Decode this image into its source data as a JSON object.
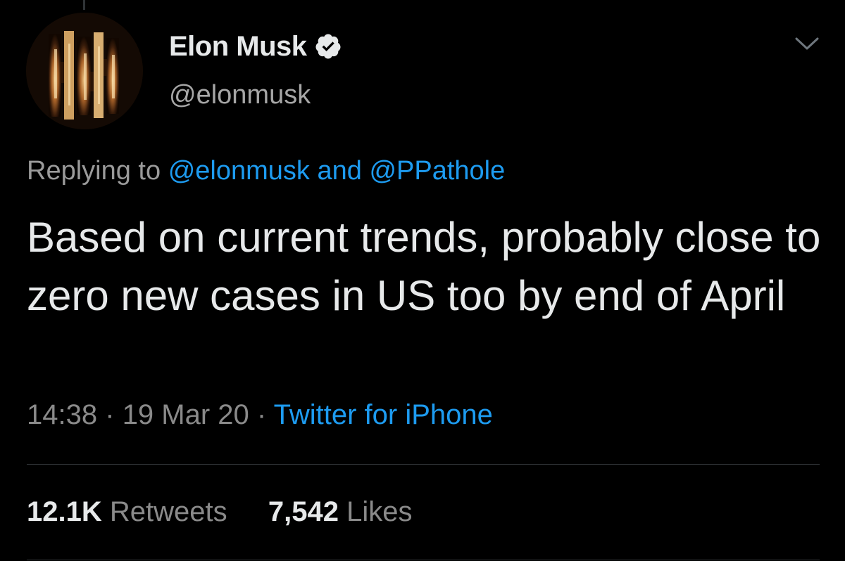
{
  "tweet": {
    "author": {
      "display_name": "Elon Musk",
      "handle": "@elonmusk",
      "verified": true,
      "avatar_icon": "fire-avatar"
    },
    "replying": {
      "prefix": "Replying to",
      "mention_1": "@elonmusk",
      "connector": "and",
      "mention_2": "@PPathole"
    },
    "text": "Based on current trends, probably close to zero new cases in US too by end of April",
    "time": "14:38",
    "separator": "·",
    "date": "19 Mar 20",
    "source": "Twitter for iPhone",
    "stats": {
      "retweets_count": "12.1K",
      "retweets_label": "Retweets",
      "likes_count": "7,542",
      "likes_label": "Likes"
    }
  },
  "colors": {
    "background": "#000000",
    "link": "#1d9bf0",
    "primary_text": "#e7e9ea",
    "secondary_text": "#8a8a8a"
  },
  "icons": {
    "verified": "verified-badge-icon",
    "more": "chevron-down-icon"
  }
}
